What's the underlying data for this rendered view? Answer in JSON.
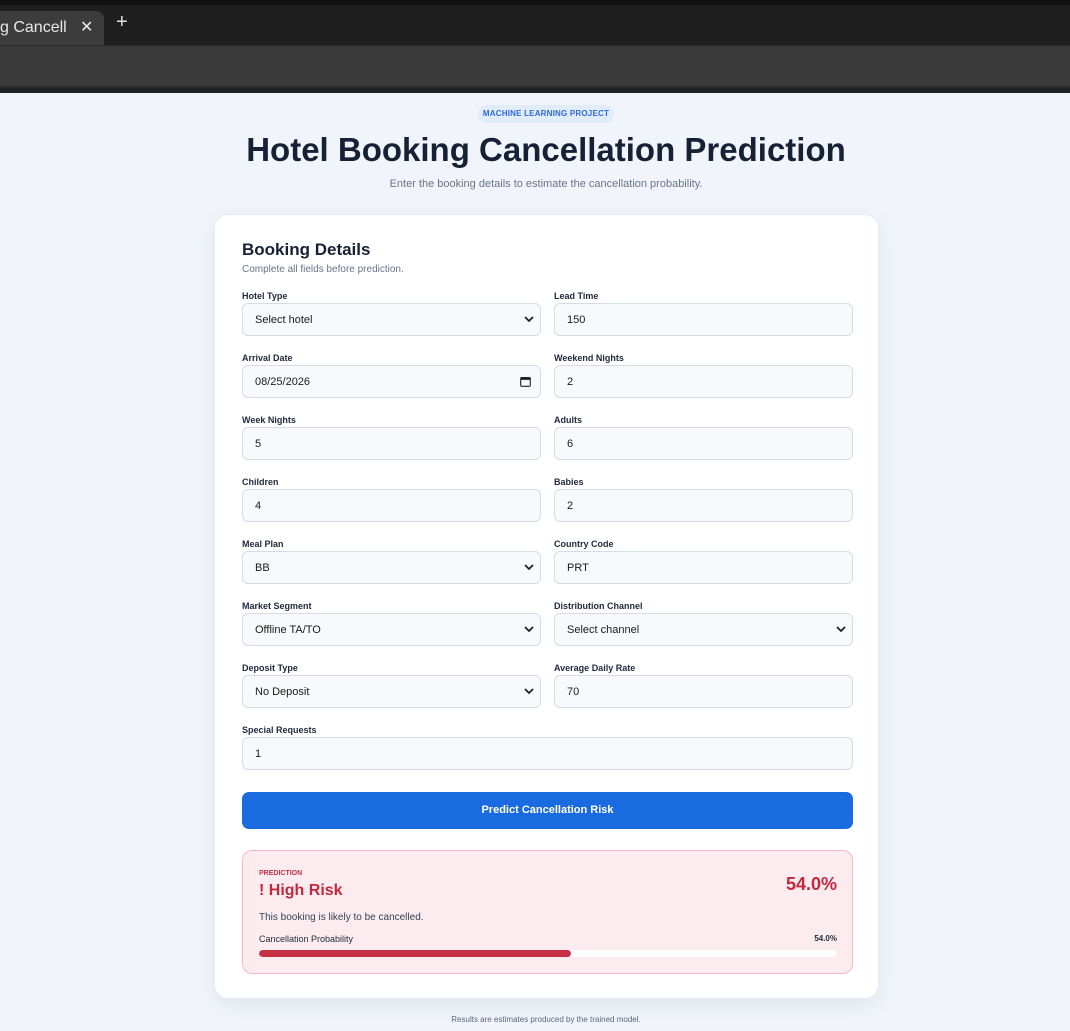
{
  "browser": {
    "tab_title": "g Cancell",
    "close_glyph": "✕",
    "new_tab_glyph": "+"
  },
  "header": {
    "badge": "MACHINE LEARNING PROJECT",
    "title": "Hotel Booking Cancellation Prediction",
    "subtitle": "Enter the booking details to estimate the cancellation probability."
  },
  "form": {
    "title": "Booking Details",
    "subtitle": "Complete all fields before prediction.",
    "fields": {
      "hotel_type": {
        "label": "Hotel Type",
        "value": "Select hotel"
      },
      "lead_time": {
        "label": "Lead Time",
        "value": "150"
      },
      "arrival_date": {
        "label": "Arrival Date",
        "value": "08/25/2026"
      },
      "weekend_nights": {
        "label": "Weekend Nights",
        "value": "2"
      },
      "week_nights": {
        "label": "Week Nights",
        "value": "5"
      },
      "adults": {
        "label": "Adults",
        "value": "6"
      },
      "children": {
        "label": "Children",
        "value": "4"
      },
      "babies": {
        "label": "Babies",
        "value": "2"
      },
      "meal_plan": {
        "label": "Meal Plan",
        "value": "BB"
      },
      "country_code": {
        "label": "Country Code",
        "value": "PRT"
      },
      "market_segment": {
        "label": "Market Segment",
        "value": "Offline TA/TO"
      },
      "distribution_channel": {
        "label": "Distribution Channel",
        "value": "Select channel"
      },
      "deposit_type": {
        "label": "Deposit Type",
        "value": "No Deposit"
      },
      "average_daily_rate": {
        "label": "Average Daily Rate",
        "value": "70"
      },
      "special_requests": {
        "label": "Special Requests",
        "value": "1"
      }
    },
    "submit_label": "Predict Cancellation Risk"
  },
  "result": {
    "kicker": "PREDICTION",
    "title": "! High Risk",
    "percent_text": "54.0%",
    "description": "This booking is likely to be cancelled.",
    "probability_label": "Cancellation Probability",
    "probability_text": "54.0%",
    "probability_fraction": 0.54,
    "accent_color": "#c62f44"
  },
  "footer": {
    "text": "Results are estimates produced by the trained model."
  },
  "colors": {
    "primary_button": "#1a6be0",
    "page_background": "#f1f5fb",
    "risk_background": "#fdecef"
  }
}
